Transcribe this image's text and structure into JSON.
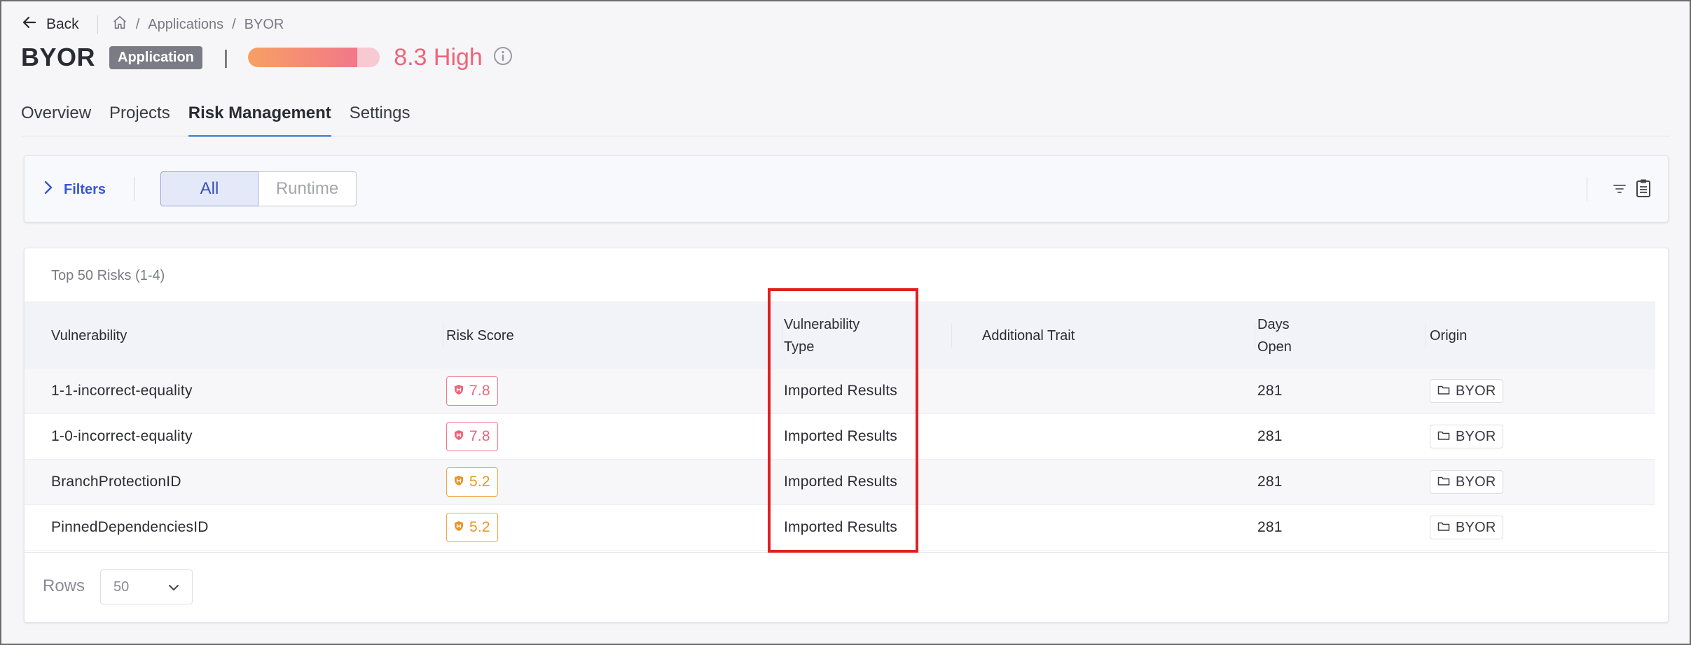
{
  "header": {
    "back_label": "Back",
    "breadcrumb": [
      "Applications",
      "BYOR"
    ],
    "title": "BYOR",
    "badge": "Application",
    "risk_score_text": "8.3 High",
    "risk_fraction": 0.83,
    "risk_color": "#f0637a"
  },
  "tabs": [
    {
      "label": "Overview",
      "active": false
    },
    {
      "label": "Projects",
      "active": false
    },
    {
      "label": "Risk Management",
      "active": true
    },
    {
      "label": "Settings",
      "active": false
    }
  ],
  "filters": {
    "toggle_label": "Filters",
    "segments": [
      {
        "label": "All",
        "active": true
      },
      {
        "label": "Runtime",
        "active": false
      }
    ]
  },
  "table": {
    "caption": "Top 50 Risks (1-4)",
    "columns": [
      "Vulnerability",
      "Risk Score",
      "Vulnerability Type",
      "Additional Trait",
      "Days Open",
      "Origin"
    ],
    "rows": [
      {
        "vulnerability": "1-1-incorrect-equality",
        "risk_score": "7.8",
        "severity": "high",
        "type": "Imported Results",
        "trait": "",
        "days_open": "281",
        "origin": "BYOR"
      },
      {
        "vulnerability": "1-0-incorrect-equality",
        "risk_score": "7.8",
        "severity": "high",
        "type": "Imported Results",
        "trait": "",
        "days_open": "281",
        "origin": "BYOR"
      },
      {
        "vulnerability": "BranchProtectionID",
        "risk_score": "5.2",
        "severity": "medium",
        "type": "Imported Results",
        "trait": "",
        "days_open": "281",
        "origin": "BYOR"
      },
      {
        "vulnerability": "PinnedDependenciesID",
        "risk_score": "5.2",
        "severity": "medium",
        "type": "Imported Results",
        "trait": "",
        "days_open": "281",
        "origin": "BYOR"
      }
    ],
    "rows_label": "Rows",
    "rows_per_page": "50"
  },
  "colors": {
    "accent": "#2f7de0",
    "filters_link": "#3755d3",
    "high": "#f0637a",
    "medium": "#e9962c",
    "highlight": "#e02020"
  }
}
